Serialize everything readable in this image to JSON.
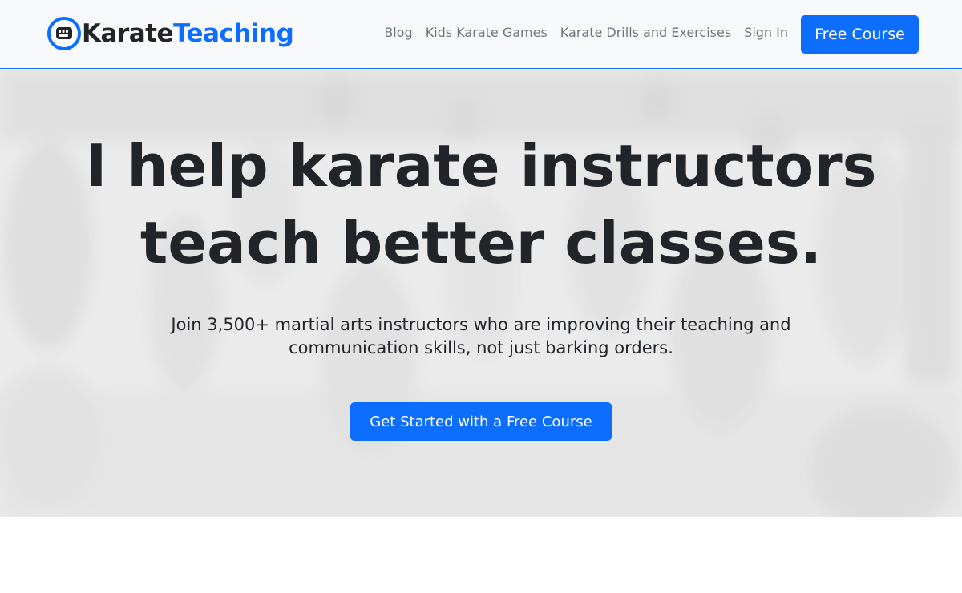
{
  "brand": {
    "part1": "Karate",
    "part2": "Teaching",
    "logo_icon": "fist-icon"
  },
  "nav": {
    "items": [
      {
        "label": "Blog"
      },
      {
        "label": "Kids Karate Games"
      },
      {
        "label": "Karate Drills and Exercises"
      },
      {
        "label": "Sign In"
      }
    ],
    "cta_label": "Free Course"
  },
  "hero": {
    "title_line1": "I help karate instructors",
    "title_line2": "teach better classes.",
    "lead_line1": "Join 3,500+ martial arts instructors who are improving their teaching and",
    "lead_line2": "communication skills, not just barking orders.",
    "cta_label": "Get Started with a Free Course",
    "background": "faded grayscale photo of a karate class"
  },
  "colors": {
    "primary": "#0d6efd",
    "text": "#212529",
    "muted": "#6c757d",
    "navbar_bg": "#f8f9fa"
  }
}
